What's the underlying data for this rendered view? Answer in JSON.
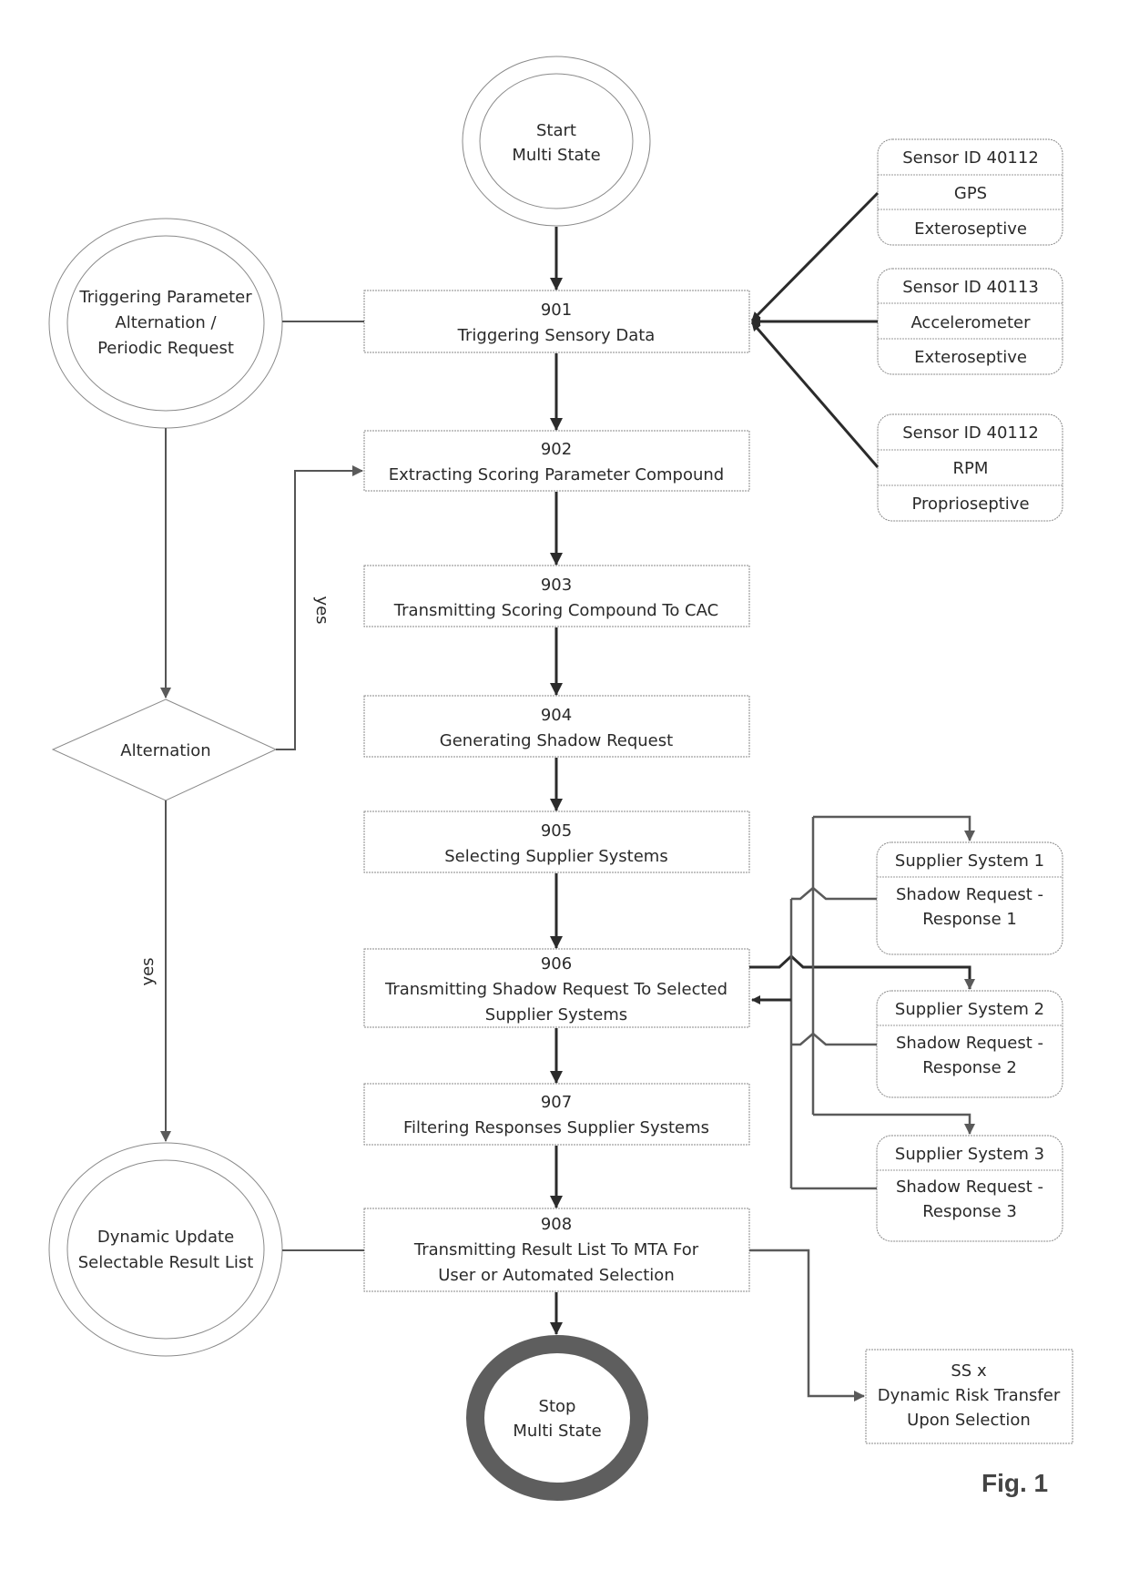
{
  "figure_label": "Fig. 1",
  "start": {
    "line1": "Start",
    "line2": "Multi State"
  },
  "stop": {
    "line1": "Stop",
    "line2": "Multi State"
  },
  "trigger_circle": {
    "line1": "Triggering Parameter",
    "line2": "Alternation /",
    "line3": "Periodic Request"
  },
  "update_circle": {
    "line1": "Dynamic Update",
    "line2": "Selectable Result List"
  },
  "decision": {
    "label": "Alternation",
    "yes_up": "yes",
    "yes_down": "yes"
  },
  "steps": [
    {
      "id": "901",
      "lines": [
        "Triggering Sensory Data"
      ]
    },
    {
      "id": "902",
      "lines": [
        "Extracting Scoring Parameter Compound"
      ]
    },
    {
      "id": "903",
      "lines": [
        "Transmitting Scoring Compound To CAC"
      ]
    },
    {
      "id": "904",
      "lines": [
        "Generating Shadow Request"
      ]
    },
    {
      "id": "905",
      "lines": [
        "Selecting Supplier Systems"
      ]
    },
    {
      "id": "906",
      "lines": [
        "Transmitting Shadow Request To Selected",
        "Supplier Systems"
      ]
    },
    {
      "id": "907",
      "lines": [
        "Filtering Responses Supplier Systems"
      ]
    },
    {
      "id": "908",
      "lines": [
        "Transmitting Result List To MTA For",
        "User or Automated Selection"
      ]
    }
  ],
  "sensors": [
    {
      "id_label": "Sensor ID  40112",
      "type": "GPS",
      "category": "Exteroseptive"
    },
    {
      "id_label": "Sensor ID  40113",
      "type": "Accelerometer",
      "category": "Exteroseptive"
    },
    {
      "id_label": "Sensor ID  40112",
      "type": "RPM",
      "category": "Proprioseptive"
    }
  ],
  "suppliers": [
    {
      "name": "Supplier System 1",
      "line1": "Shadow Request  -",
      "line2": "Response 1"
    },
    {
      "name": "Supplier System 2",
      "line1": "Shadow Request -",
      "line2": "Response 2"
    },
    {
      "name": "Supplier System 3",
      "line1": "Shadow Request -",
      "line2": "Response 3"
    }
  ],
  "risk_transfer": {
    "line1": "SS x",
    "line2": "Dynamic Risk Transfer",
    "line3": "Upon Selection"
  }
}
